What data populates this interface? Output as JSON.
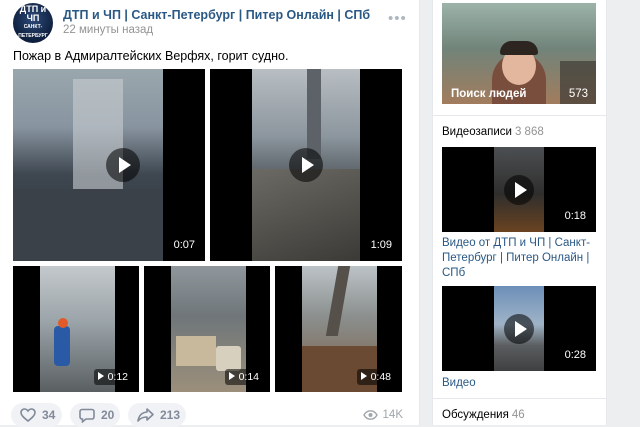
{
  "post": {
    "avatar_line1": "ДТП и ЧП",
    "avatar_line2": "САНКТ-ПЕТЕРБУРГ",
    "author": "ДТП и ЧП | Санкт-Петербург | Питер Онлайн | СПб",
    "time": "22 минуты назад",
    "more": "•••",
    "text": "Пожар в Адмиралтейских Верфях, горит судно.",
    "videos": [
      {
        "duration": "0:07"
      },
      {
        "duration": "1:09"
      },
      {
        "duration": "0:12"
      },
      {
        "duration": "0:14"
      },
      {
        "duration": "0:48"
      }
    ],
    "actions": {
      "likes": "34",
      "comments": "20",
      "shares": "213",
      "views": "14K"
    }
  },
  "sidebar": {
    "people_label": "Поиск людей",
    "people_count": "573",
    "videos_title": "Видеозаписи",
    "videos_count": "3 868",
    "video1_duration": "0:18",
    "video1_title": "Видео от ДТП и ЧП | Санкт-Петербург | Питер Онлайн | СПб",
    "video2_duration": "0:28",
    "video2_title": "Видео",
    "discussions_title": "Обсуждения",
    "discussions_count": "46"
  },
  "colors": {
    "link": "#2a5885",
    "muted": "#939393",
    "action_bg": "#f0f2f5"
  }
}
